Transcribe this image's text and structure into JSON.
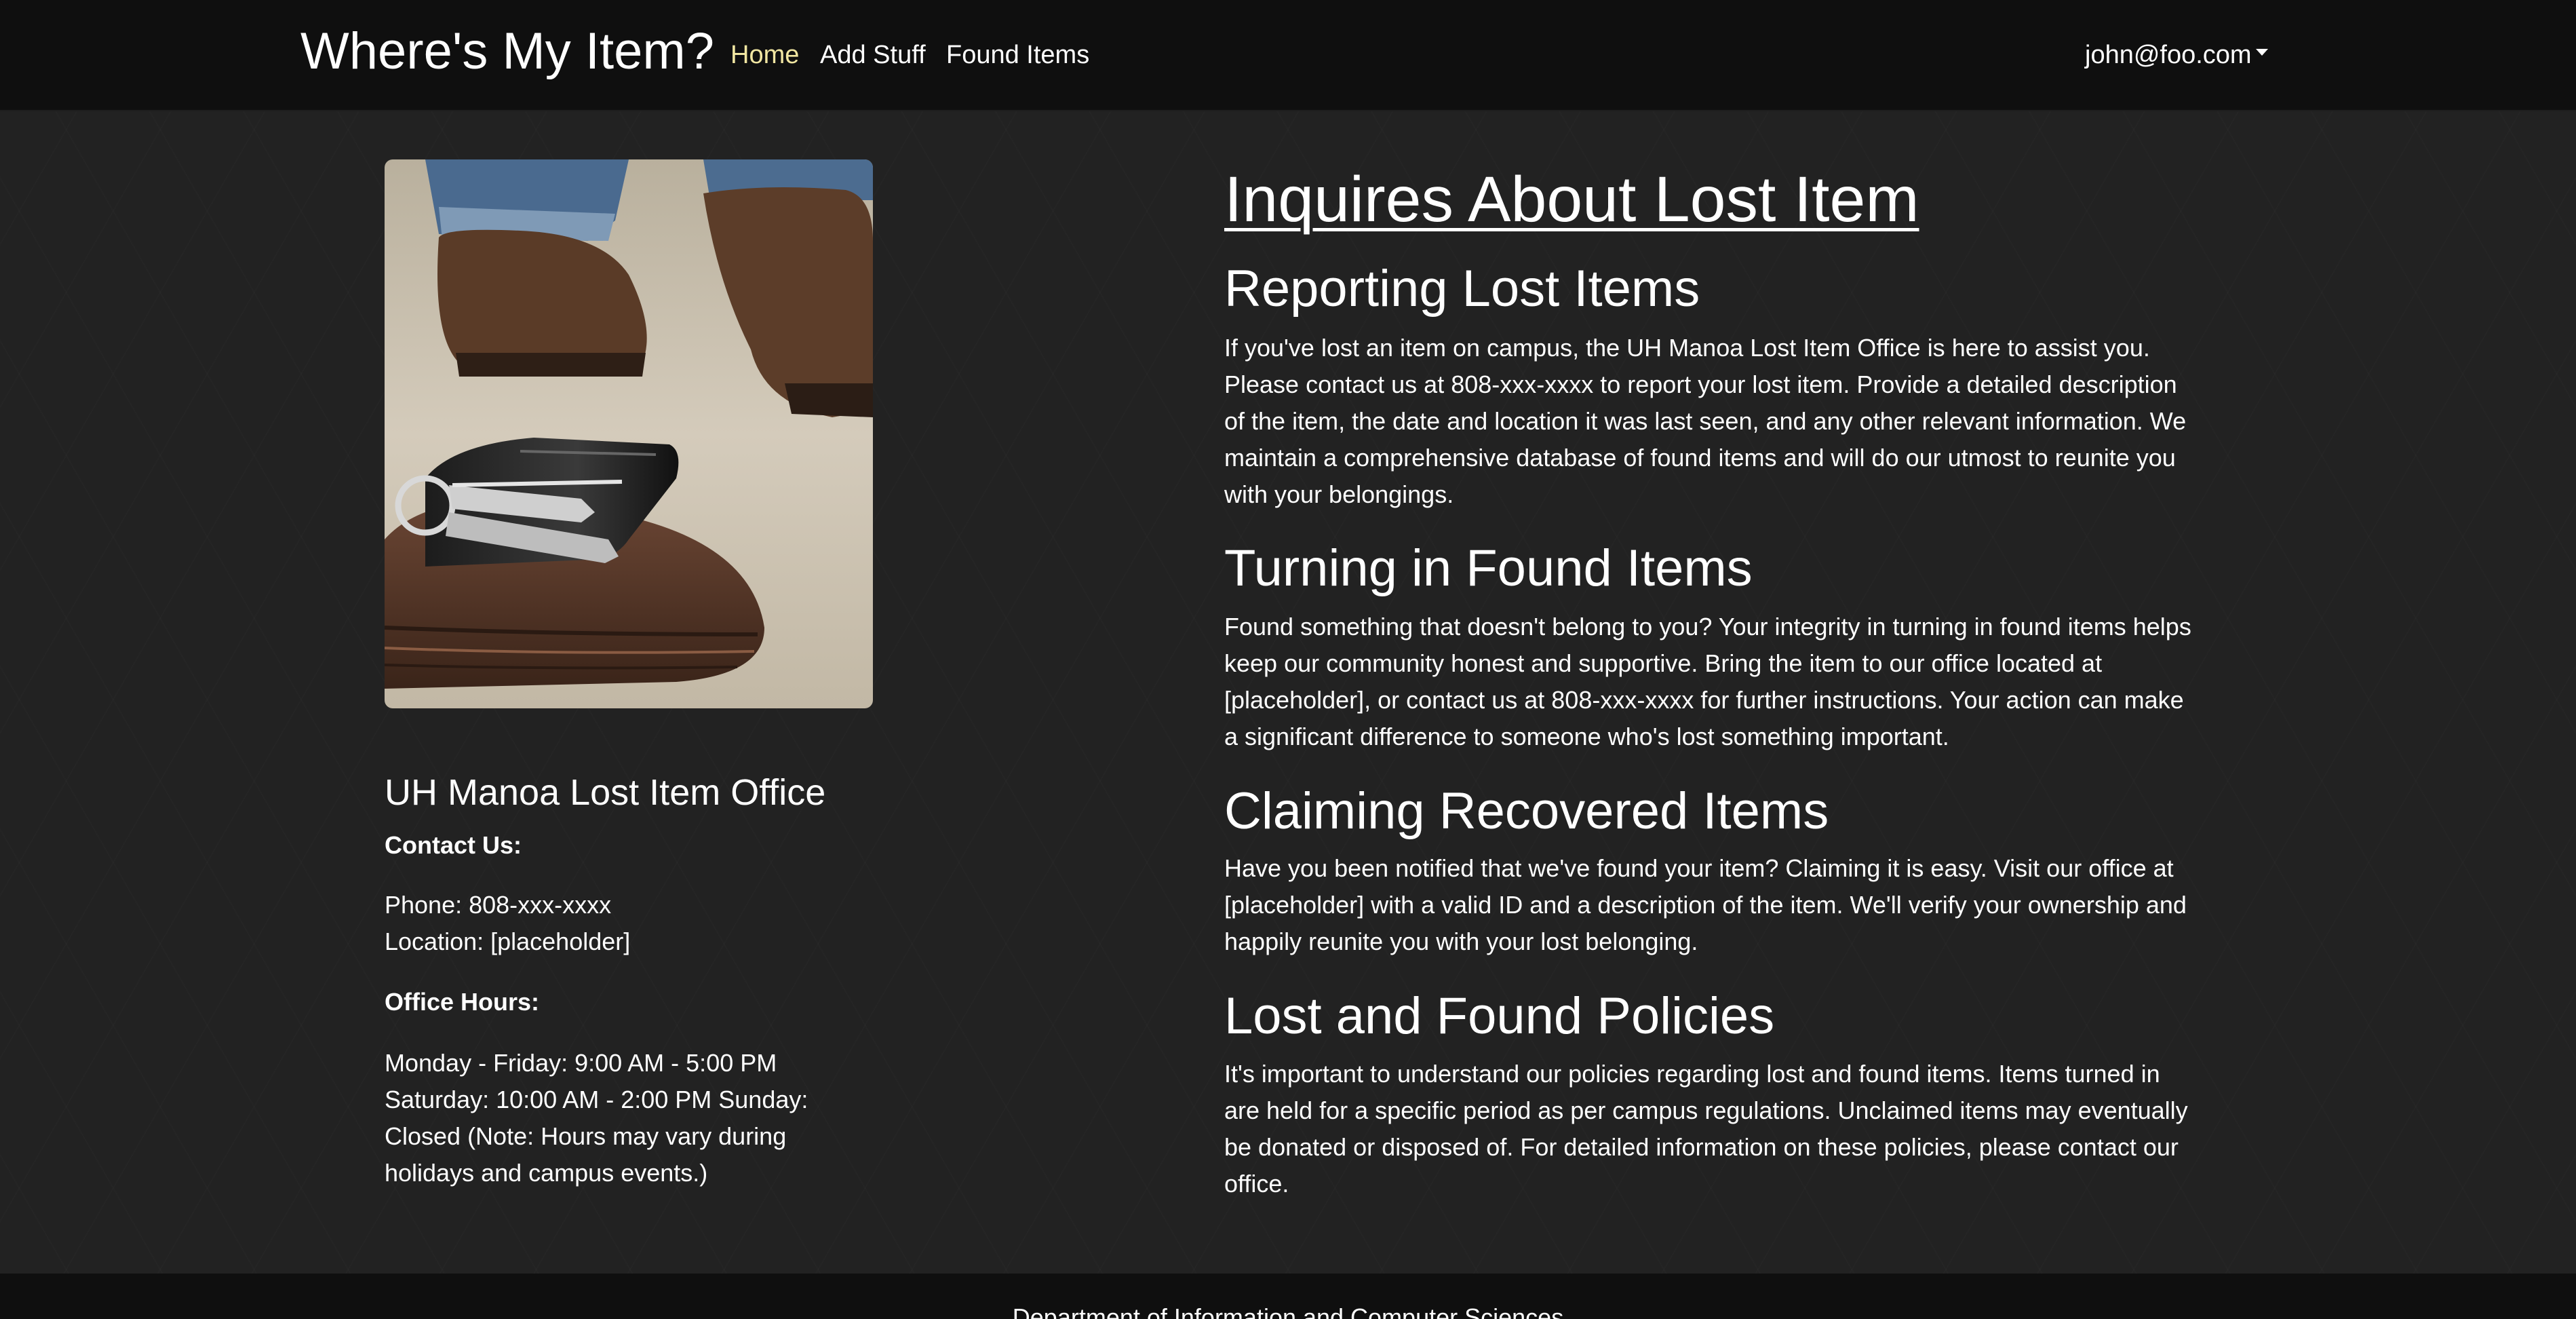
{
  "navbar": {
    "brand": "Where's My Item?",
    "links": [
      {
        "label": "Home",
        "active": true
      },
      {
        "label": "Add Stuff",
        "active": false
      },
      {
        "label": "Found Items",
        "active": false
      }
    ],
    "user": "john@foo.com"
  },
  "left": {
    "office_title": "UH Manoa Lost Item Office",
    "contact_heading": "Contact Us:",
    "phone": "Phone: 808-xxx-xxxx",
    "location": "Location: [placeholder]",
    "hours_heading": "Office Hours:",
    "hours_lines": [
      "Monday - Friday: 9:00 AM - 5:00 PM",
      "Saturday: 10:00 AM - 2:00 PM Sunday:",
      "Closed (Note: Hours may vary during",
      "holidays and campus events.)"
    ]
  },
  "main": {
    "title": "Inquires About Lost Item",
    "sections": [
      {
        "heading": "Reporting Lost Items",
        "body": "If you've lost an item on campus, the UH Manoa Lost Item Office is here to assist you. Please contact us at 808-xxx-xxxx to report your lost item. Provide a detailed description of the item, the date and location it was last seen, and any other relevant information. We maintain a comprehensive database of found items and will do our utmost to reunite you with your belongings."
      },
      {
        "heading": "Turning in Found Items",
        "body": "Found something that doesn't belong to you? Your integrity in turning in found items helps keep our community honest and supportive. Bring the item to our office located at [placeholder], or contact us at 808-xxx-xxxx for further instructions. Your action can make a significant difference to someone who's lost something important."
      },
      {
        "heading": "Claiming Recovered Items",
        "body": "Have you been notified that we've found your item? Claiming it is easy. Visit our office at [placeholder] with a valid ID and a description of the item. We'll verify your ownership and happily reunite you with your lost belonging."
      },
      {
        "heading": "Lost and Found Policies",
        "body": "It's important to understand our policies regarding lost and found items. Items turned in are held for a specific period as per campus regulations. Unclaimed items may eventually be donated or disposed of. For detailed information on these policies, please contact our office."
      }
    ]
  },
  "footer": {
    "text": "Department of Information and Computer Sciences"
  },
  "colors": {
    "navbar_bg": "#0f0f0f",
    "page_bg": "#222222",
    "active_link": "#f1e6a2"
  }
}
